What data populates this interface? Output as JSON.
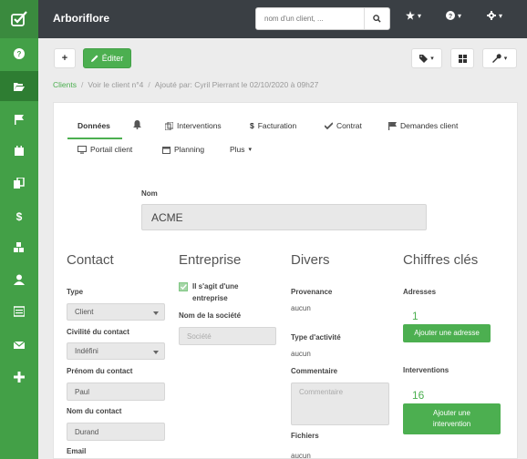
{
  "app": {
    "title": "Arboriflore"
  },
  "search": {
    "placeholder": "nom d'un client, ..."
  },
  "toolbar": {
    "add_label": "+",
    "edit_label": "Éditer"
  },
  "breadcrumb": {
    "root": "Clients",
    "current": "Voir le client n°4",
    "meta": "Ajouté par: Cyril Pierrant le 02/10/2020 à 09h27"
  },
  "tabs": [
    {
      "label": "Données"
    },
    {
      "label": ""
    },
    {
      "label": "Interventions"
    },
    {
      "label": "Facturation"
    },
    {
      "label": "Contrat"
    },
    {
      "label": "Demandes client"
    },
    {
      "label": "Portail client"
    },
    {
      "label": "Planning"
    },
    {
      "label": "Plus"
    }
  ],
  "form": {
    "nom_label": "Nom",
    "nom_value": "ACME",
    "contact": {
      "title": "Contact",
      "type_label": "Type",
      "type_value": "Client",
      "civilite_label": "Civilité du contact",
      "civilite_value": "Indéfini",
      "prenom_label": "Prénom du contact",
      "prenom_value": "Paul",
      "nom_label": "Nom du contact",
      "nom_value": "Durand",
      "email_label": "Email"
    },
    "entreprise": {
      "title": "Entreprise",
      "checkbox_label_1": "Il s'agit d'une",
      "checkbox_label_2": "entreprise",
      "societe_label": "Nom de la société",
      "societe_placeholder": "Société"
    },
    "divers": {
      "title": "Divers",
      "provenance_label": "Provenance",
      "provenance_value": "aucun",
      "activite_label": "Type d'activité",
      "activite_value": "aucun",
      "commentaire_label": "Commentaire",
      "commentaire_placeholder": "Commentaire",
      "fichiers_label": "Fichiers",
      "fichiers_value": "aucun"
    },
    "chiffres": {
      "title": "Chiffres clés",
      "adresses_label": "Adresses",
      "adresses_count": "1",
      "adresses_button": "Ajouter une adresse",
      "interventions_label": "Interventions",
      "interventions_count": "16",
      "interventions_button_1": "Ajouter une",
      "interventions_button_2": "intervention"
    }
  },
  "colors": {
    "brand": "#4caf50",
    "sidebar": "#43a047",
    "topbar": "#3a3f44"
  }
}
